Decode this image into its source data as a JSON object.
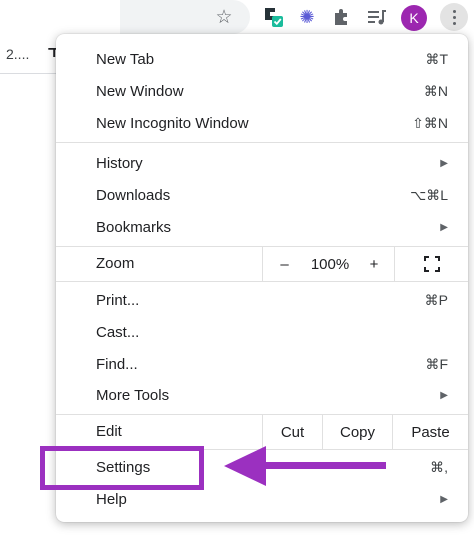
{
  "toolbar": {
    "avatar_letter": "K",
    "accent": "#9c27b0"
  },
  "page": {
    "tab_fragment": "2....",
    "tab_fragment2": "ד"
  },
  "menu": {
    "new_tab": {
      "label": "New Tab",
      "shortcut": "⌘T"
    },
    "new_window": {
      "label": "New Window",
      "shortcut": "⌘N"
    },
    "new_incognito": {
      "label": "New Incognito Window",
      "shortcut": "⇧⌘N"
    },
    "history": {
      "label": "History"
    },
    "downloads": {
      "label": "Downloads",
      "shortcut": "⌥⌘L"
    },
    "bookmarks": {
      "label": "Bookmarks"
    },
    "zoom": {
      "label": "Zoom",
      "minus": "–",
      "value": "100%",
      "plus": "+"
    },
    "print": {
      "label": "Print...",
      "shortcut": "⌘P"
    },
    "cast": {
      "label": "Cast..."
    },
    "find": {
      "label": "Find...",
      "shortcut": "⌘F"
    },
    "more_tools": {
      "label": "More Tools"
    },
    "edit": {
      "label": "Edit",
      "cut": "Cut",
      "copy": "Copy",
      "paste": "Paste"
    },
    "settings": {
      "label": "Settings",
      "shortcut": "⌘,"
    },
    "help": {
      "label": "Help"
    }
  },
  "annotation": {
    "color": "#9b30c0"
  }
}
